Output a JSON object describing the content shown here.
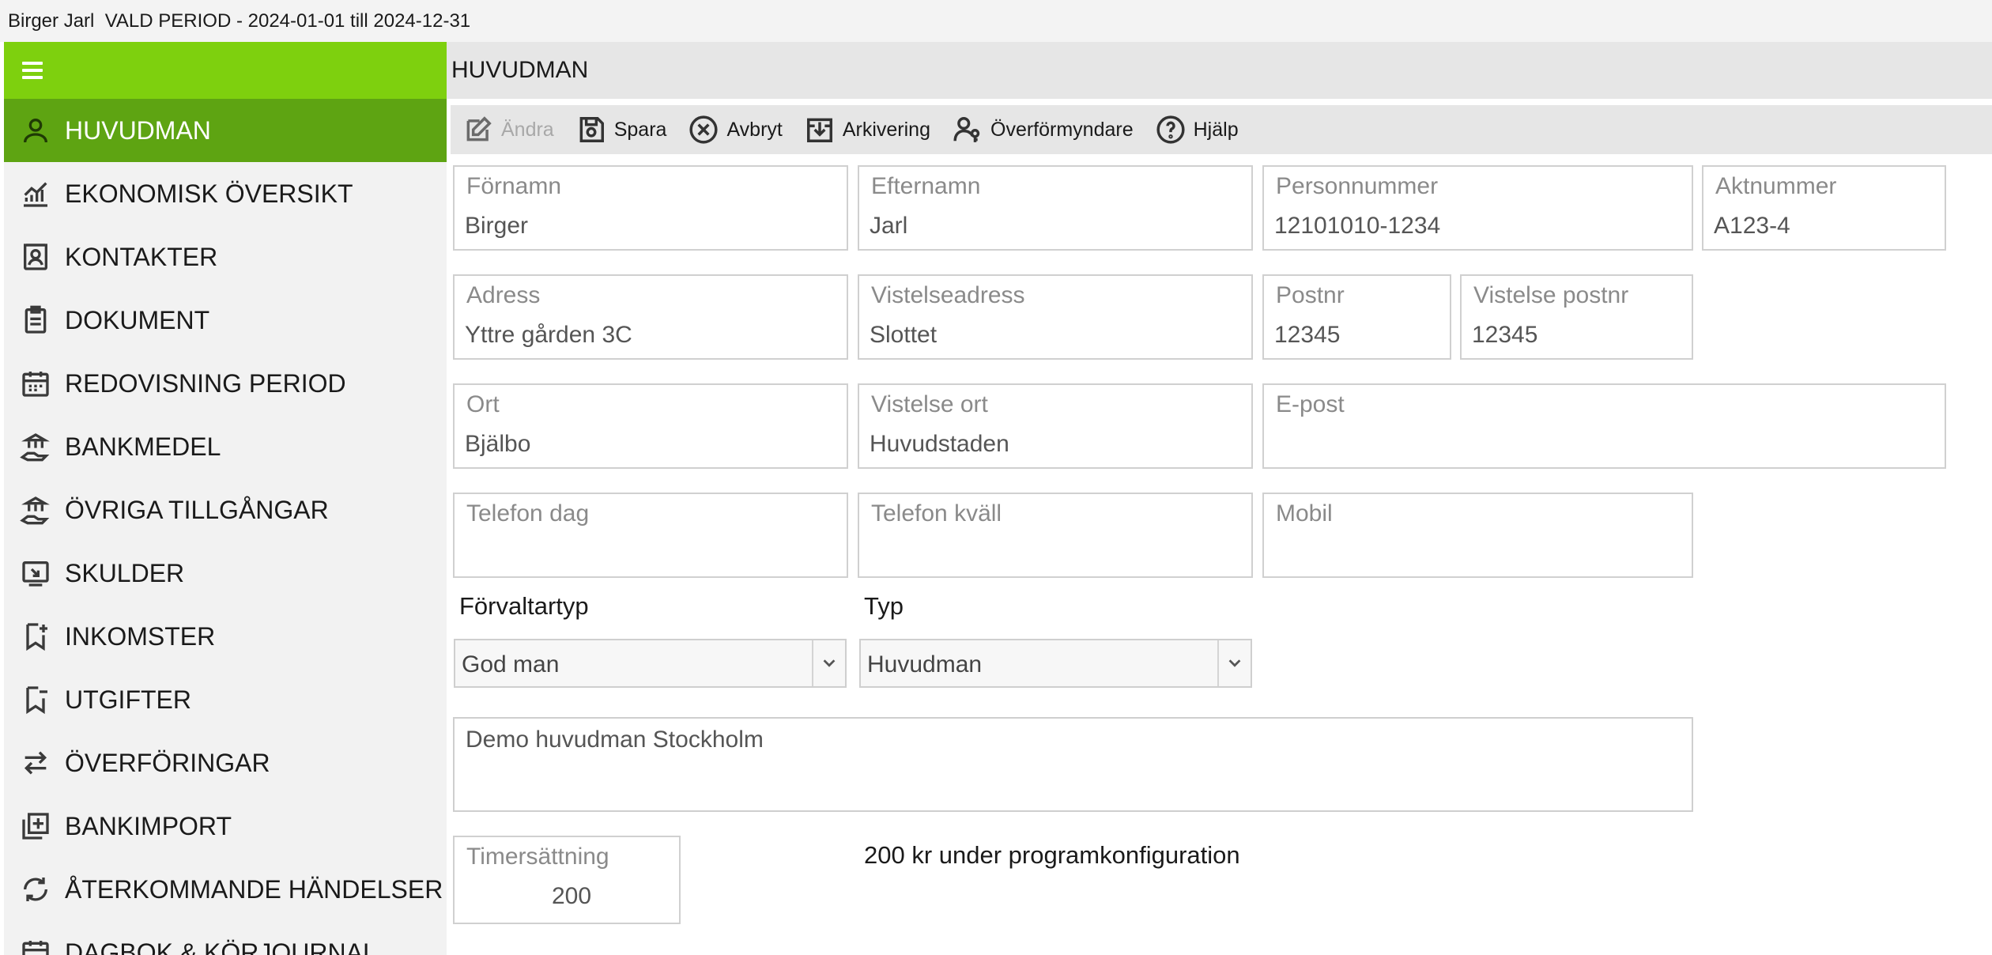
{
  "window": {
    "title": "Birger Jarl  VALD PERIOD - 2024-01-01 till 2024-12-31"
  },
  "sidebar": {
    "items": [
      {
        "label": "HUVUDMAN",
        "icon": "person-icon",
        "active": true
      },
      {
        "label": "EKONOMISK ÖVERSIKT",
        "icon": "chart-icon",
        "active": false
      },
      {
        "label": "KONTAKTER",
        "icon": "contact-card-icon",
        "active": false
      },
      {
        "label": "DOKUMENT",
        "icon": "clipboard-icon",
        "active": false
      },
      {
        "label": "REDOVISNING PERIOD",
        "icon": "calendar-icon",
        "active": false
      },
      {
        "label": "BANKMEDEL",
        "icon": "bank-hand-icon",
        "active": false
      },
      {
        "label": "ÖVRIGA TILLGÅNGAR",
        "icon": "assets-hand-icon",
        "active": false
      },
      {
        "label": "SKULDER",
        "icon": "debt-icon",
        "active": false
      },
      {
        "label": "INKOMSTER",
        "icon": "bookmark-add-icon",
        "active": false
      },
      {
        "label": "UTGIFTER",
        "icon": "bookmark-remove-icon",
        "active": false
      },
      {
        "label": "ÖVERFÖRINGAR",
        "icon": "transfer-arrows-icon",
        "active": false
      },
      {
        "label": "BANKIMPORT",
        "icon": "import-icon",
        "active": false
      },
      {
        "label": "ÅTERKOMMANDE HÄNDELSER",
        "icon": "recurring-icon",
        "active": false
      },
      {
        "label": "DAGBOK & KÖRJOURNAL",
        "icon": "journal-icon",
        "active": false
      }
    ]
  },
  "header": {
    "title": "HUVUDMAN"
  },
  "toolbar": {
    "edit": "Ändra",
    "save": "Spara",
    "cancel": "Avbryt",
    "archive": "Arkivering",
    "transfer_guardian": "Överförmyndare",
    "help": "Hjälp"
  },
  "form": {
    "fornamn": {
      "label": "Förnamn",
      "value": "Birger"
    },
    "efternamn": {
      "label": "Efternamn",
      "value": "Jarl"
    },
    "personnummer": {
      "label": "Personnummer",
      "value": "12101010-1234"
    },
    "aktnummer": {
      "label": "Aktnummer",
      "value": "A123-4"
    },
    "adress": {
      "label": "Adress",
      "value": "Yttre gården 3C"
    },
    "vistelseadress": {
      "label": "Vistelseadress",
      "value": "Slottet"
    },
    "postnr": {
      "label": "Postnr",
      "value": "12345"
    },
    "vistelse_postnr": {
      "label": "Vistelse postnr",
      "value": "12345"
    },
    "ort": {
      "label": "Ort",
      "value": "Bjälbo"
    },
    "vistelse_ort": {
      "label": "Vistelse ort",
      "value": "Huvudstaden"
    },
    "epost": {
      "label": "E-post",
      "value": ""
    },
    "telefon_dag": {
      "label": "Telefon dag",
      "value": ""
    },
    "telefon_kvall": {
      "label": "Telefon kväll",
      "value": ""
    },
    "mobil": {
      "label": "Mobil",
      "value": ""
    },
    "forvaltartyp": {
      "label": "Förvaltartyp",
      "value": "God man"
    },
    "typ": {
      "label": "Typ",
      "value": "Huvudman"
    },
    "notes": "Demo huvudman Stockholm",
    "timersattning": {
      "label": "Timersättning",
      "value": "200"
    },
    "timersattning_note": "200 kr under programkonfiguration"
  }
}
